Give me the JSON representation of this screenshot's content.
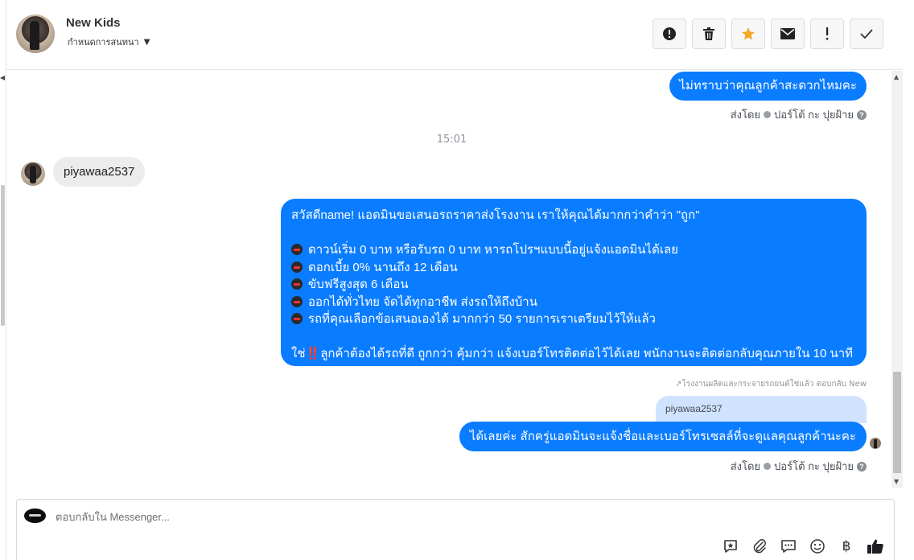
{
  "header": {
    "contact_name": "New Kids",
    "assign_label": "กำหนดการสนทนา",
    "toolbar": [
      {
        "name": "alert-button",
        "icon": "exclamation-circle-icon"
      },
      {
        "name": "delete-button",
        "icon": "trash-icon"
      },
      {
        "name": "star-button",
        "icon": "star-icon",
        "color": "#f5a623"
      },
      {
        "name": "mail-button",
        "icon": "envelope-icon"
      },
      {
        "name": "priority-button",
        "icon": "exclamation-icon"
      },
      {
        "name": "done-button",
        "icon": "check-icon"
      }
    ]
  },
  "conversation": {
    "msg_out_1": "ไม่ทราบว่าคุณลูกค้าสะดวกไหมคะ",
    "sent_by_label": "ส่งโดย",
    "sender_name": "ปอร์โต้ กะ ปุยฝ้าย",
    "timestamp": "15:01",
    "msg_in_1": "piyawaa2537",
    "msg_out_2": {
      "line1": "สวัสดีname! แอดมินขอเสนอรถราคาส่งโรงงาน เราให้คุณได้มากกว่าคำว่า \"ถูก\"",
      "bullets": [
        "ดาวน์เริ่ม 0 บาท หรือรับรถ 0 บาท หารถโปรฯแบบนี้อยู่แจ้งแอดมินได้เลย",
        "ดอกเบี้ย 0% นานถึง 12 เดือน",
        "ขับฟรีสูงสุด 6 เดือน",
        "ออกได้ทั่วไทย จัดได้ทุกอาชีพ ส่งรถให้ถึงบ้าน",
        "รถที่คุณเลือกข้อเสนอเองได้ มากกว่า 50 รายการเราเตรียมไว้ให้แล้ว"
      ],
      "closing_prefix": "ใช่",
      "closing_bang": "‼️",
      "closing": "ลูกค้าต้องได้รถที่ดี ถูกกว่า คุ้มกว่า แจ้งเบอร์โทรติดต่อไว้ได้เลย พนักงานจะติดต่อกลับคุณภายใน 10 นาที"
    },
    "reply_note": "↗โรงงานผลิตและกระจายรถยนต์ใช่แล้ว ตอบกลับ New",
    "quoted_text": "piyawaa2537",
    "msg_out_3": "ได้เลยค่ะ สักครู่แอดมินจะแจ้งชื่อและเบอร์โทรเซลล์ที่จะดูแลคุณลูกค้านะคะ"
  },
  "composer": {
    "placeholder": "ตอบกลับใน Messenger...",
    "tools": [
      "quick-reply-icon",
      "attachment-icon",
      "chat-bubbles-icon",
      "emoji-icon",
      "baht-icon",
      "thumbs-up-icon"
    ],
    "baht_symbol": "฿"
  },
  "colors": {
    "accent": "#0a7cff",
    "incoming_bubble": "#ececec",
    "quoted_bubble": "#cfe3ff"
  }
}
